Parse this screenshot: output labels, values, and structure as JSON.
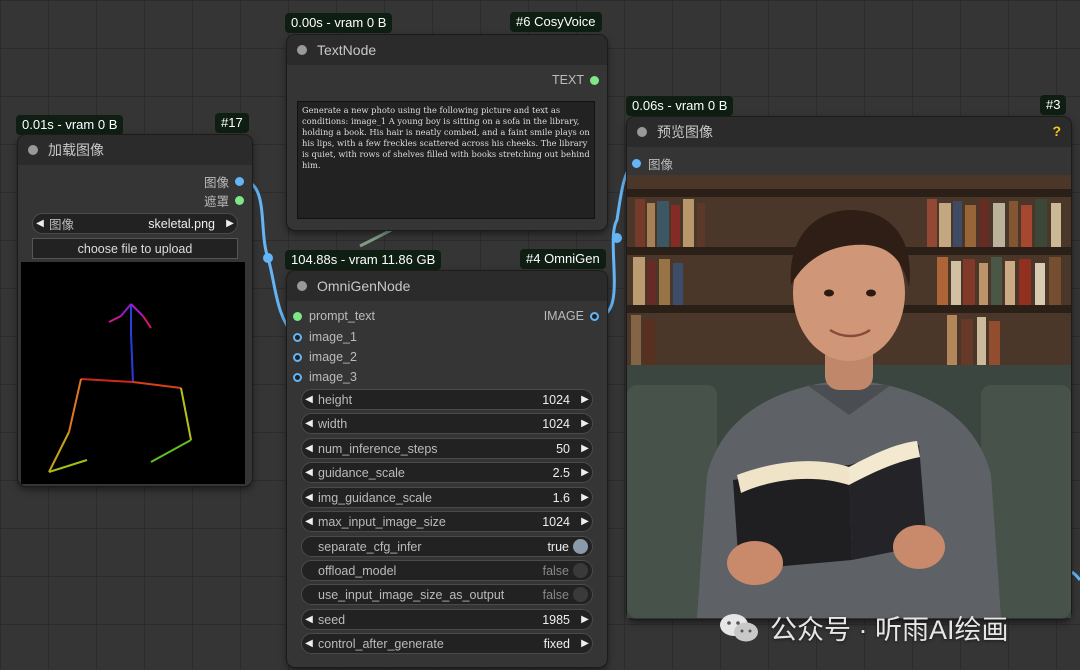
{
  "nodes": {
    "load_image": {
      "timing": "0.01s - vram 0 B",
      "id": "#17",
      "title": "加载图像",
      "outputs": [
        "图像",
        "遮罩"
      ],
      "image_widget_label": "图像",
      "image_widget_value": "skeletal.png",
      "upload_button": "choose file to upload"
    },
    "text_node": {
      "timing": "0.00s - vram 0 B",
      "id": "#6 CosyVoice",
      "title": "TextNode",
      "output": "TEXT",
      "text": "Generate a new photo using the following picture and text as conditions: image_1 A young boy is sitting on a sofa in the library, holding a book. His hair is neatly combed, and a faint smile plays on his lips, with a few freckles scattered across his cheeks. The library is quiet, with rows of shelves filled with books stretching out behind him."
    },
    "omnigen": {
      "timing": "104.88s - vram 11.86 GB",
      "id": "#4 OmniGen",
      "title": "OmniGenNode",
      "inputs": [
        "prompt_text",
        "image_1",
        "image_2",
        "image_3"
      ],
      "output": "IMAGE",
      "widgets": [
        {
          "label": "height",
          "value": "1024"
        },
        {
          "label": "width",
          "value": "1024"
        },
        {
          "label": "num_inference_steps",
          "value": "50"
        },
        {
          "label": "guidance_scale",
          "value": "2.5"
        },
        {
          "label": "img_guidance_scale",
          "value": "1.6"
        },
        {
          "label": "max_input_image_size",
          "value": "1024"
        },
        {
          "label": "separate_cfg_infer",
          "value": "true"
        },
        {
          "label": "offload_model",
          "value": "false"
        },
        {
          "label": "use_input_image_size_as_output",
          "value": "false"
        },
        {
          "label": "seed",
          "value": "1985"
        },
        {
          "label": "control_after_generate",
          "value": "fixed"
        }
      ]
    },
    "preview": {
      "timing": "0.06s - vram 0 B",
      "id": "#3",
      "title": "预览图像",
      "input": "图像",
      "help_icon": "?"
    }
  },
  "watermark": {
    "text": "公众号 · 听雨AI绘画",
    "icon": "wechat-icon"
  },
  "colors": {
    "canvas": "#353535",
    "link_image": "#64b5f6",
    "slot_text": "#7ee787",
    "badge_bg": "#0f1e13",
    "help": "#f5c518"
  }
}
